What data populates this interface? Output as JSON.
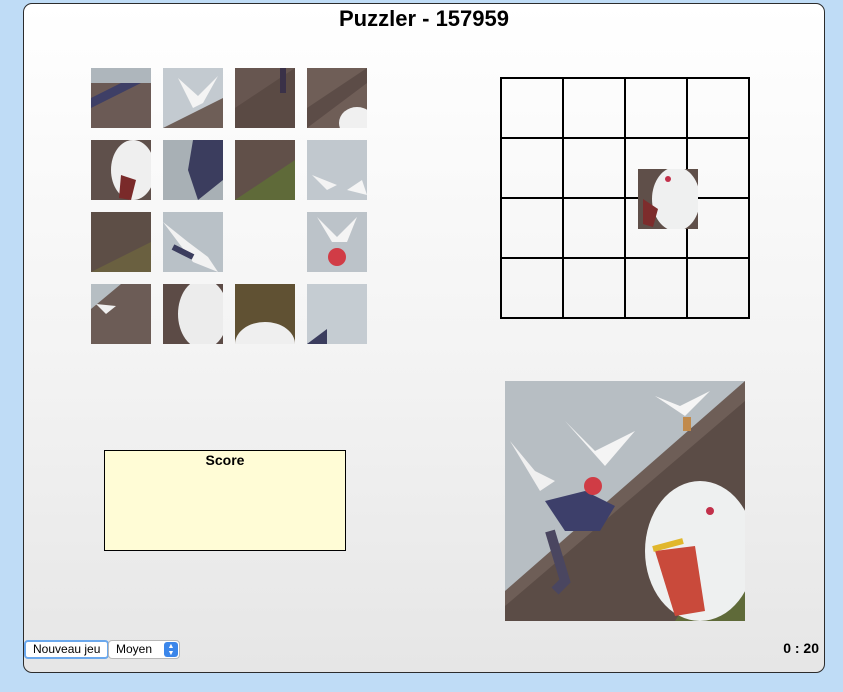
{
  "title": "Puzzler - 157959",
  "score": {
    "label": "Score"
  },
  "controls": {
    "new_game_label": "Nouveau jeu",
    "difficulty_selected": "Moyen",
    "timer": "0 : 20"
  },
  "grid": {
    "rows": 4,
    "cols": 4
  },
  "pieces": [
    {
      "name": "piece-r1c1",
      "scene": "hiker-arm"
    },
    {
      "name": "piece-r1c2",
      "scene": "gull-sky"
    },
    {
      "name": "piece-r1c3",
      "scene": "hill-legs"
    },
    {
      "name": "piece-r1c4",
      "scene": "hill-gull-head"
    },
    {
      "name": "piece-r2c1",
      "scene": "gull-beak-dark"
    },
    {
      "name": "piece-r2c2",
      "scene": "hiker-body"
    },
    {
      "name": "piece-r2c3",
      "scene": "hill-grass"
    },
    {
      "name": "piece-r2c4",
      "scene": "gulls-flying"
    },
    {
      "name": "piece-r3c1",
      "scene": "grass-slope"
    },
    {
      "name": "piece-r3c2",
      "scene": "gull-wings"
    },
    {
      "name": "piece-r3c3",
      "scene": "empty"
    },
    {
      "name": "piece-r3c4",
      "scene": "gull-red-hat"
    },
    {
      "name": "piece-r4c1",
      "scene": "slope-gull-small"
    },
    {
      "name": "piece-r4c2",
      "scene": "gull-neck"
    },
    {
      "name": "piece-r4c3",
      "scene": "grass-gull-head"
    },
    {
      "name": "piece-r4c4",
      "scene": "sky-corner"
    }
  ],
  "placed_piece": {
    "scene": "gull-eye-beak"
  }
}
